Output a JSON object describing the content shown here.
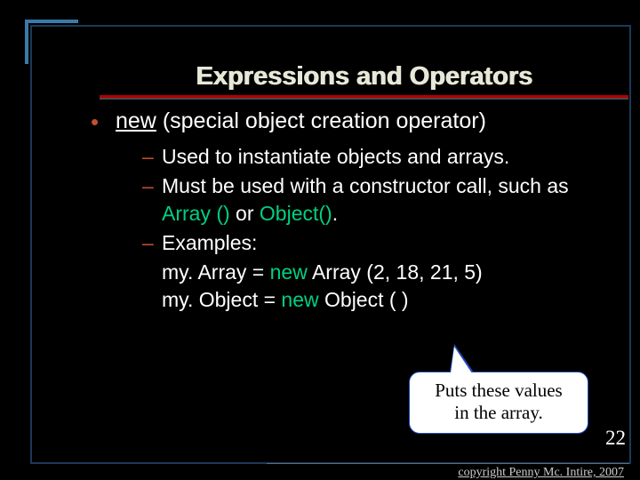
{
  "title": "Expressions and Operators",
  "bullet": {
    "keyword": "new",
    "rest": " (special object creation operator)"
  },
  "sub": {
    "s1": "Used to instantiate objects and arrays.",
    "s2a": "Must be used with a constructor call, such as ",
    "s2b": "Array ()",
    "s2c": " or ",
    "s2d": "Object()",
    "s2e": ".",
    "s3": "Examples:"
  },
  "ex": {
    "e1a": "my. Array = ",
    "e1b": "new",
    "e1c": " Array (2, 18, 21, 5)",
    "e2a": "my. Object = ",
    "e2b": "new",
    "e2c": " Object ( )"
  },
  "callout": {
    "l1": "Puts these values",
    "l2": "in the array."
  },
  "page": "22",
  "copyright": "copyright Penny Mc. Intire, 2007"
}
